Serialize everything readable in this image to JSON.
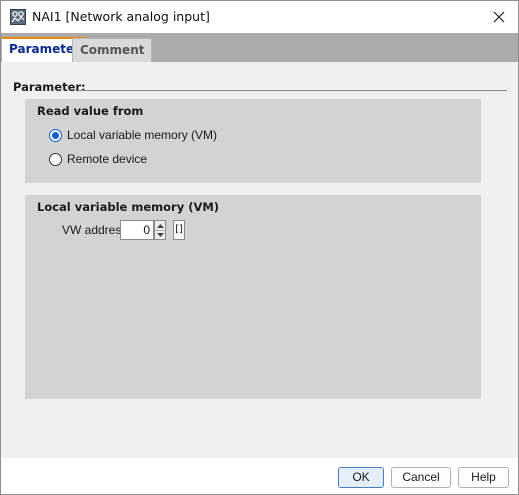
{
  "window": {
    "title": "NAI1 [Network analog input]",
    "icon": "network-analog-input-icon"
  },
  "tabs": [
    {
      "label": "Parameter",
      "active": true
    },
    {
      "label": "Comment",
      "active": false
    }
  ],
  "parameter": {
    "heading": "Parameter:",
    "read_value_group": {
      "title": "Read value from",
      "options": [
        {
          "label": "Local variable memory (VM)",
          "selected": true
        },
        {
          "label": "Remote device",
          "selected": false
        }
      ]
    },
    "vm_group": {
      "title": "Local variable memory (VM)",
      "vw_address_label": "VW address:",
      "vw_address_value": "0",
      "range_button_label": "[]"
    }
  },
  "footer": {
    "ok_label": "OK",
    "cancel_label": "Cancel",
    "help_label": "Help"
  },
  "colors": {
    "active_tab_accent": "#e98a10",
    "active_tab_text": "#0a2a8c",
    "radio_selected": "#0a5fc8",
    "group_background": "#d3d3d3",
    "tabstrip_background": "#ababab"
  }
}
